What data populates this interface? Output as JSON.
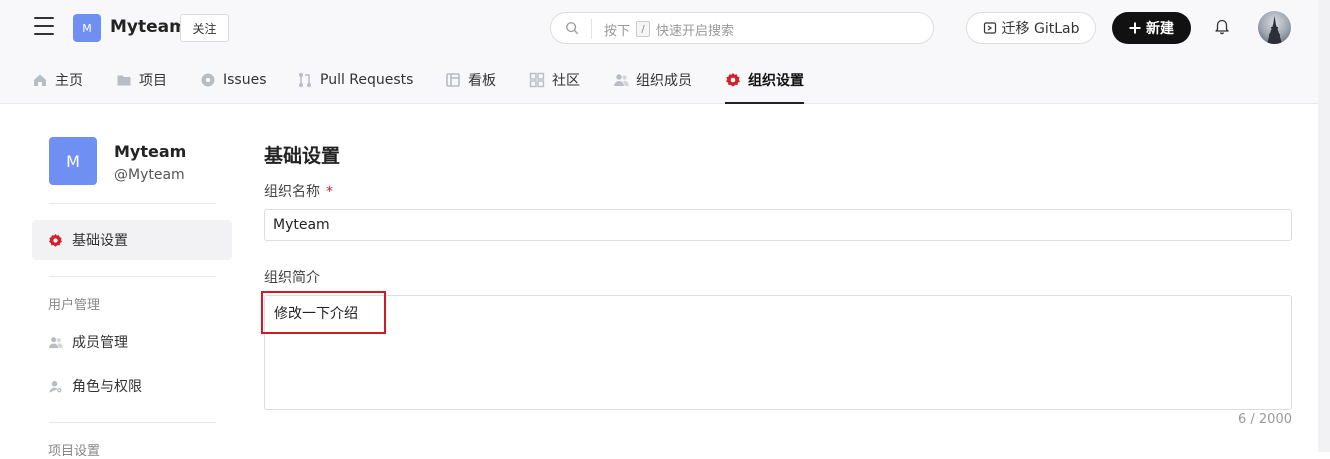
{
  "header": {
    "org_avatar_letter": "M",
    "org_name": "Myteam",
    "follow_label": "关注",
    "search": {
      "hint_prefix": "按下",
      "hint_key": "/",
      "hint_suffix": "快速开启搜索"
    },
    "migrate_label": "迁移 GitLab",
    "new_label": "新建"
  },
  "nav": {
    "tabs": [
      {
        "label": "主页",
        "icon": "home-icon"
      },
      {
        "label": "项目",
        "icon": "folder-icon"
      },
      {
        "label": "Issues",
        "icon": "issue-icon"
      },
      {
        "label": "Pull Requests",
        "icon": "pull-request-icon"
      },
      {
        "label": "看板",
        "icon": "board-icon"
      },
      {
        "label": "社区",
        "icon": "community-icon"
      },
      {
        "label": "组织成员",
        "icon": "members-icon"
      },
      {
        "label": "组织设置",
        "icon": "settings-gear-icon",
        "active": true
      }
    ]
  },
  "sidebar": {
    "avatar_letter": "M",
    "name": "Myteam",
    "handle": "@Myteam",
    "active_item": "基础设置",
    "section_user": "用户管理",
    "member_mgmt": "成员管理",
    "roles": "角色与权限",
    "section_project": "项目设置"
  },
  "main": {
    "title": "基础设置",
    "name_label": "组织名称",
    "required_mark": "*",
    "name_value": "Myteam",
    "intro_label": "组织简介",
    "intro_value": "修改一下介绍",
    "counter": "6 / 2000"
  },
  "colors": {
    "accent": "#d3202a",
    "avatar": "#6f8ff3",
    "primary_button": "#111111"
  }
}
